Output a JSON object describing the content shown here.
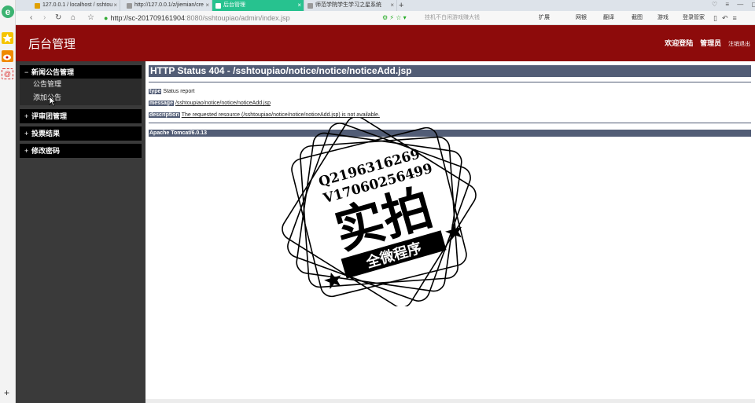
{
  "browser": {
    "tabs": [
      {
        "label": "127.0.0.1 / localhost / sshtou"
      },
      {
        "label": "http://127.0.0.1/z/jiemian/cre"
      },
      {
        "label": "后台管理"
      },
      {
        "label": "师范学院学生学习之星系统"
      }
    ],
    "address": {
      "host": "http://sc-201709161904",
      "path": ":8080/sshtoupiao/admin/index.jsp"
    },
    "search_placeholder": "挂机不白闲游戏赚大钱",
    "tools": [
      "扩展",
      "网银",
      "翻译",
      "截图",
      "游戏",
      "登录管家"
    ]
  },
  "header": {
    "title": "后台管理",
    "welcome": "欢迎登陆",
    "user": "管理员",
    "logout": "注销退出"
  },
  "sidebar": {
    "groups": [
      {
        "sign": "−",
        "label": "新闻公告管理",
        "items": [
          {
            "label": "公告管理"
          },
          {
            "label": "添加公告"
          }
        ]
      },
      {
        "sign": "+",
        "label": "评审团管理"
      },
      {
        "sign": "+",
        "label": "投票结果"
      },
      {
        "sign": "+",
        "label": "修改密码"
      }
    ]
  },
  "error": {
    "title": "HTTP Status 404 - /sshtoupiao/notice/notice/noticeAdd.jsp",
    "type_label": "type",
    "type_value": "Status report",
    "message_label": "message",
    "message_value": "/sshtoupiao/notice/notice/noticeAdd.jsp",
    "description_label": "description",
    "description_value": "The requested resource (/sshtoupiao/notice/notice/noticeAdd.jsp) is not available.",
    "server": "Apache Tomcat/6.0.13"
  },
  "watermark": {
    "line1": "Q2196316269",
    "line2": "V17060256499",
    "big": "实拍",
    "ribbon": "全微程序"
  },
  "colors": {
    "header_bg": "#8d0b0b",
    "sidebar_bg": "#3a3a3a",
    "tomcat_bar": "#525d76",
    "active_tab": "#27c28f"
  }
}
